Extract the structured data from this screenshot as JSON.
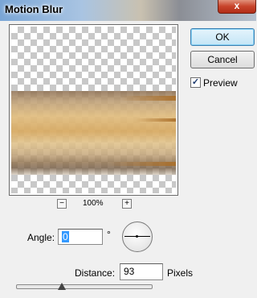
{
  "window": {
    "title": "Motion Blur",
    "close_glyph": "x"
  },
  "preview": {
    "zoom_level": "100%",
    "zoom_out_glyph": "−",
    "zoom_in_glyph": "+"
  },
  "buttons": {
    "ok_label": "OK",
    "cancel_label": "Cancel"
  },
  "preview_toggle": {
    "label": "Preview",
    "checked": true,
    "check_glyph": "✓"
  },
  "angle": {
    "label": "Angle:",
    "value": "0",
    "unit": "°"
  },
  "distance": {
    "label": "Distance:",
    "value": "93",
    "unit": "Pixels"
  },
  "colors": {
    "default_button": "#c4e5f6",
    "accent": "#3399ff",
    "close_button": "#c7442b"
  },
  "icons": [
    "close-icon",
    "zoom-out-icon",
    "zoom-in-icon",
    "angle-dial-icon",
    "checkmark-icon",
    "slider-thumb-icon"
  ]
}
